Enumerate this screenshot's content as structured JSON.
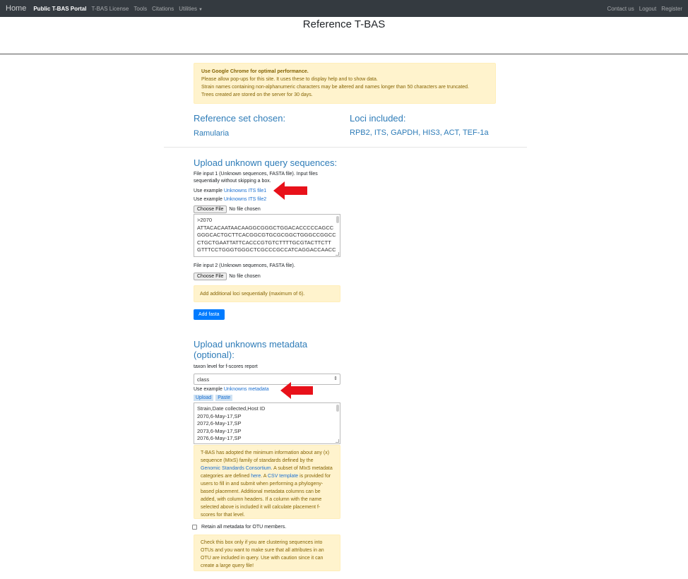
{
  "nav": {
    "brand": "Home",
    "items": [
      "Public T-BAS Portal",
      "T-BAS License",
      "Tools",
      "Citations",
      "Utilities"
    ],
    "right_items": [
      "Contact us",
      "Logout",
      "Register"
    ]
  },
  "page": {
    "title": "Reference T-BAS"
  },
  "notice": {
    "bold_line": "Use Google Chrome for optimal performance.",
    "line2": "Please allow pop-ups for this site. It uses these to display help and to show data.",
    "line3": "Strain names containing non-alphanumeric characters may be altered and names longer than 50 characters are truncated.",
    "line4": "Trees created are stored on the server for 30 days."
  },
  "reference": {
    "label": "Reference set chosen:",
    "value": "Ramularia",
    "loci_label": "Loci included:",
    "loci_value": "RPB2, ITS, GAPDH, HIS3, ACT, TEF-1a"
  },
  "upload_sequences": {
    "heading": "Upload unknown query sequences:",
    "file1_desc": "File input 1 (Unknown sequences, FASTA file). Input files sequentially without skipping a box.",
    "use_example_prefix": "Use example",
    "example1": "Unknowns ITS file1",
    "example2": "Unknowns ITS file2",
    "choose_file": "Choose File",
    "no_file": "No file chosen",
    "sequence_lines": [
      ">2070",
      "ATTACACAATAACAAGGCGGGCTGGACACCCCCAGCC",
      "GGGCACTGCTTCACGGCGTGCGCGGCTGGGCCGGCC",
      "CTGCTGAATTATTCACCCGTGTCTTTTGCGTACTTCTT",
      "GTTTCCTGGGTGGGCTCGCCCGCCATCAGGACCAACC"
    ],
    "file2_desc": "File input 2 (Unknown sequences, FASTA file).",
    "add_loci_notice": "Add additional loci sequentially (maximum of 6).",
    "add_fasta": "Add fasta"
  },
  "upload_metadata": {
    "heading_line1": "Upload unknowns metadata",
    "heading_line2": "(optional):",
    "taxon_label": "taxon level for f-scores report",
    "taxon_selected": "class",
    "use_example_prefix": "Use example",
    "example": "Unknowns metadata",
    "tabs": [
      "Upload",
      "Paste"
    ],
    "metadata_lines": [
      "Strain,Date collected,Host ID",
      "2070,6-May-17,SP",
      "2072,6-May-17,SP",
      "2073,6-May-17,SP",
      "2076,6-May-17,SP"
    ],
    "mixs_text_1": "T-BAS has adopted the minimum information about any (x) sequence (MIxS) family of standards defined by the ",
    "mixs_link_gsc": "Genomic Standards Consortium",
    "mixs_text_2": ". A subset of MIxS metadata categories are defined ",
    "mixs_link_here": "here",
    "mixs_text_3": ". A ",
    "mixs_link_csv": "CSV template",
    "mixs_text_4": " is provided for users to fill in and submit when performing a phylogeny-based placement. Additional metadata columns can be added, with column headers. If a column with the name selected above is included it will calculate placement f-scores for that level.",
    "retain_label": "Retain all metadata for OTU members.",
    "retain_notice": "Check this box only if you are clustering sequences into OTUs and you want to make sure that all attributes in an OTU are included in query. Use with caution since it can create a large query file!"
  },
  "colors": {
    "navbar": "#343a40",
    "heading_blue": "#2e7cb8",
    "link_blue": "#1a6fd1",
    "alert_bg": "#fff3cd",
    "alert_text": "#856404",
    "primary_button": "#007bff",
    "annotation_arrow": "#e8111a"
  }
}
